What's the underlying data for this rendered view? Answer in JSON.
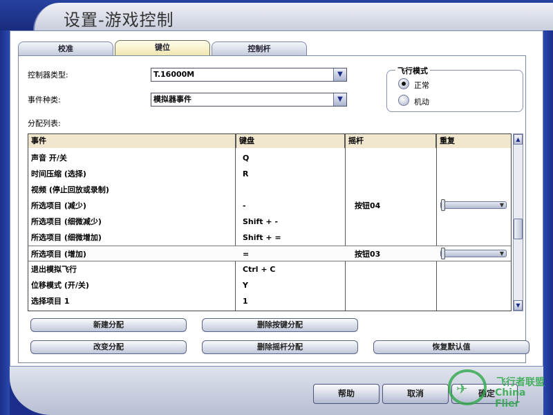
{
  "window": {
    "title": "设置-游戏控制"
  },
  "tabs": [
    {
      "label": "校准"
    },
    {
      "label": "键位"
    },
    {
      "label": "控制杆"
    }
  ],
  "controller": {
    "label": "控制器类型:",
    "value": "T.16000M"
  },
  "event_type": {
    "label": "事件种类:",
    "value": "模拟器事件"
  },
  "flight_mode": {
    "title": "飞行模式",
    "options": [
      {
        "label": "正常",
        "checked": true
      },
      {
        "label": "机动",
        "checked": false
      }
    ]
  },
  "assign_list": {
    "label": "分配列表:",
    "columns": [
      "事件",
      "键盘",
      "摇杆",
      "重复"
    ],
    "rows": [
      {
        "event": "声音 开/关",
        "keyboard": "Q",
        "joystick": "",
        "repeat": false
      },
      {
        "event": "时间压缩 (选择)",
        "keyboard": "R",
        "joystick": "",
        "repeat": false
      },
      {
        "event": "视频 (停止回放或录制)",
        "keyboard": "",
        "joystick": "",
        "repeat": false
      },
      {
        "event": "所选项目 (减少)",
        "keyboard": "-",
        "joystick": "按钮04",
        "repeat": true
      },
      {
        "event": "所选项目 (细微减少)",
        "keyboard": "Shift + -",
        "joystick": "",
        "repeat": false
      },
      {
        "event": "所选项目 (细微增加)",
        "keyboard": "Shift + =",
        "joystick": "",
        "repeat": false
      },
      {
        "event": "所选项目 (增加)",
        "keyboard": "=",
        "joystick": "按钮03",
        "repeat": true
      },
      {
        "event": "退出模拟飞行",
        "keyboard": "Ctrl + C",
        "joystick": "",
        "repeat": false
      },
      {
        "event": "位移模式 (开/关)",
        "keyboard": "Y",
        "joystick": "",
        "repeat": false
      },
      {
        "event": "选择项目 1",
        "keyboard": "1",
        "joystick": "",
        "repeat": false
      }
    ]
  },
  "actions": {
    "new_assign": "新建分配",
    "delete_key_assign": "删除按键分配",
    "change_assign": "改变分配",
    "delete_joystick_assign": "删除摇杆分配",
    "restore_defaults": "恢复默认值"
  },
  "footer": {
    "help": "帮助",
    "cancel": "取消",
    "ok": "确定"
  },
  "watermark": {
    "cn": "飞行者联盟",
    "en": "China Flier"
  },
  "colors": {
    "frame_blue": "#1b2f8a",
    "header_beige": "#f1e7cf",
    "watermark_green": "#2fa84a"
  }
}
